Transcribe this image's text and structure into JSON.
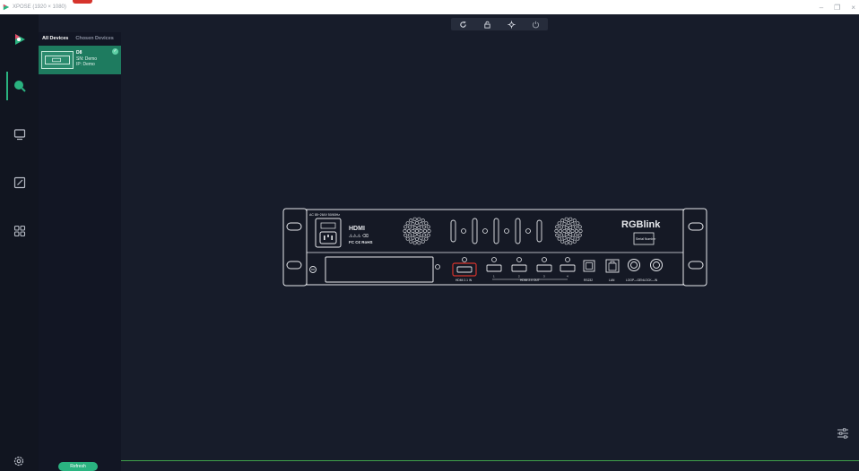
{
  "window": {
    "title": "XPOSE (1920 × 1080)",
    "controls": [
      "–",
      "❐",
      "×"
    ]
  },
  "rail": {
    "icons": [
      "xpose-logo-icon",
      "search-icon",
      "screen-icon",
      "edit-icon",
      "grid-icon",
      "settings-icon"
    ]
  },
  "device_panel": {
    "tabs": [
      "All Devices",
      "Chosen Devices"
    ],
    "active_tab": "All Devices",
    "device": {
      "model": "D8",
      "sn": "SN: Demo",
      "ip": "IP: Demo"
    }
  },
  "toolbar": {
    "icons": [
      "refresh-icon",
      "lock-icon",
      "move-icon",
      "power-icon"
    ]
  },
  "rear_panel": {
    "power_label": "AC 85~264V 50/60Hz",
    "hdmi_logo": "HDMI",
    "cert_text": "FC C€ RoHS",
    "brand": "RGBlink",
    "serial_label": "Serial Number",
    "hdmi_in_label": "HDMI 2.1 IN",
    "hdmi_out_label": "HDMI 2.0 OUT",
    "rs232_label": "RS232",
    "lan_label": "LAN",
    "genlock_label": "LOOP—GENLOCK—IN",
    "port_numbers": [
      "1",
      "2",
      "3",
      "4"
    ]
  },
  "footer": {
    "refresh_label": "Refresh"
  },
  "colors": {
    "accent": "#2ab380",
    "background": "#171c2a",
    "selected_card": "#1e7b5f",
    "highlight_port": "#d6342c"
  }
}
